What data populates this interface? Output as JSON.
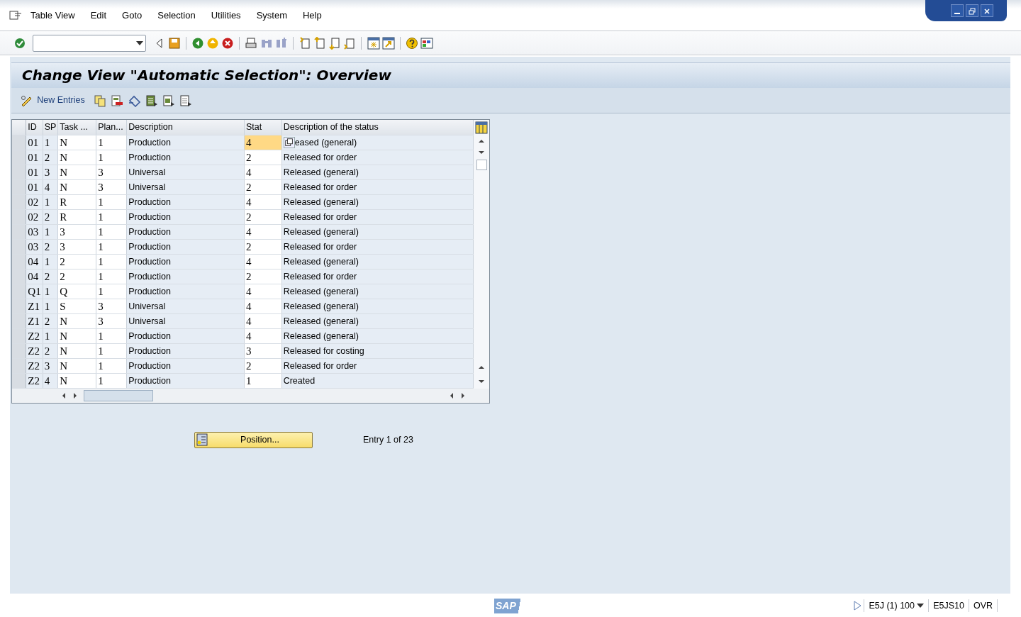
{
  "menu": [
    {
      "label": "Table View"
    },
    {
      "label": "Edit"
    },
    {
      "label": "Goto"
    },
    {
      "label": "Selection"
    },
    {
      "label": "Utilities"
    },
    {
      "label": "System"
    },
    {
      "label": "Help"
    }
  ],
  "title": "Change View \"Automatic Selection\": Overview",
  "app_toolbar": {
    "new_entries": "New Entries"
  },
  "table": {
    "columns": [
      "ID",
      "SP",
      "Task ...",
      "Plan...",
      "Description",
      "Stat",
      "Description of the status"
    ],
    "rows": [
      {
        "id": "01",
        "sp": "1",
        "task": "N",
        "plan": "1",
        "description": "Production",
        "stat": "4",
        "stat_selected": true,
        "status": "eased (general)"
      },
      {
        "id": "01",
        "sp": "2",
        "task": "N",
        "plan": "1",
        "description": "Production",
        "stat": "2",
        "stat_selected": false,
        "status": "Released for order"
      },
      {
        "id": "01",
        "sp": "3",
        "task": "N",
        "plan": "3",
        "description": "Universal",
        "stat": "4",
        "stat_selected": false,
        "status": "Released (general)"
      },
      {
        "id": "01",
        "sp": "4",
        "task": "N",
        "plan": "3",
        "description": "Universal",
        "stat": "2",
        "stat_selected": false,
        "status": "Released for order"
      },
      {
        "id": "02",
        "sp": "1",
        "task": "R",
        "plan": "1",
        "description": "Production",
        "stat": "4",
        "stat_selected": false,
        "status": "Released (general)"
      },
      {
        "id": "02",
        "sp": "2",
        "task": "R",
        "plan": "1",
        "description": "Production",
        "stat": "2",
        "stat_selected": false,
        "status": "Released for order"
      },
      {
        "id": "03",
        "sp": "1",
        "task": "3",
        "plan": "1",
        "description": "Production",
        "stat": "4",
        "stat_selected": false,
        "status": "Released (general)"
      },
      {
        "id": "03",
        "sp": "2",
        "task": "3",
        "plan": "1",
        "description": "Production",
        "stat": "2",
        "stat_selected": false,
        "status": "Released for order"
      },
      {
        "id": "04",
        "sp": "1",
        "task": "2",
        "plan": "1",
        "description": "Production",
        "stat": "4",
        "stat_selected": false,
        "status": "Released (general)"
      },
      {
        "id": "04",
        "sp": "2",
        "task": "2",
        "plan": "1",
        "description": "Production",
        "stat": "2",
        "stat_selected": false,
        "status": "Released for order"
      },
      {
        "id": "Q1",
        "sp": "1",
        "task": "Q",
        "plan": "1",
        "description": "Production",
        "stat": "4",
        "stat_selected": false,
        "status": "Released (general)"
      },
      {
        "id": "Z1",
        "sp": "1",
        "task": "S",
        "plan": "3",
        "description": "Universal",
        "stat": "4",
        "stat_selected": false,
        "status": "Released (general)"
      },
      {
        "id": "Z1",
        "sp": "2",
        "task": "N",
        "plan": "3",
        "description": "Universal",
        "stat": "4",
        "stat_selected": false,
        "status": "Released (general)"
      },
      {
        "id": "Z2",
        "sp": "1",
        "task": "N",
        "plan": "1",
        "description": "Production",
        "stat": "4",
        "stat_selected": false,
        "status": "Released (general)"
      },
      {
        "id": "Z2",
        "sp": "2",
        "task": "N",
        "plan": "1",
        "description": "Production",
        "stat": "3",
        "stat_selected": false,
        "status": "Released for costing"
      },
      {
        "id": "Z2",
        "sp": "3",
        "task": "N",
        "plan": "1",
        "description": "Production",
        "stat": "2",
        "stat_selected": false,
        "status": "Released for order"
      },
      {
        "id": "Z2",
        "sp": "4",
        "task": "N",
        "plan": "1",
        "description": "Production",
        "stat": "1",
        "stat_selected": false,
        "status": "Created"
      }
    ]
  },
  "position_button": "Position...",
  "entry_info": "Entry 1 of 23",
  "status_bar": {
    "logo": "SAP",
    "system": "E5J (1) 100",
    "server": "E5JS10",
    "mode": "OVR"
  }
}
